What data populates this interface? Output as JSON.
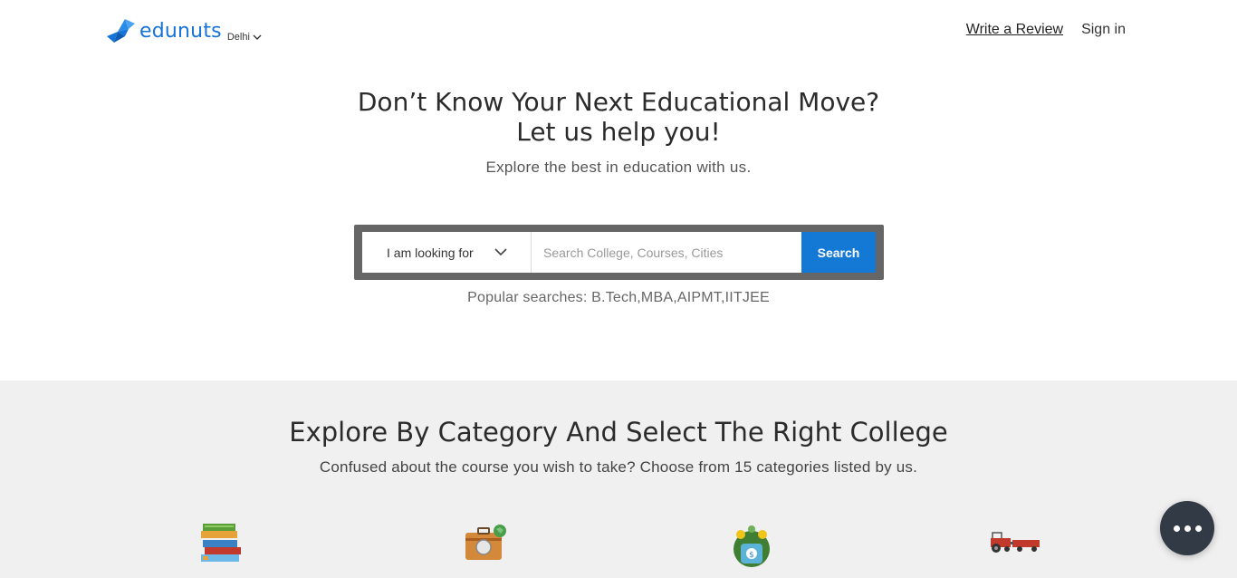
{
  "brand": {
    "name": "edunuts",
    "color": "#1673d8"
  },
  "header": {
    "city": "Delhi",
    "nav": {
      "write_review": "Write a Review",
      "sign_in": "Sign in"
    }
  },
  "hero": {
    "title_line1": "Don’t Know Your Next Educational Move?",
    "title_line2": "Let us help you!",
    "subtitle": "Explore the best in education with us."
  },
  "search": {
    "looking_for_label": "I am looking for",
    "input_placeholder": "Search College, Courses, Cities",
    "input_value": "",
    "button_label": "Search",
    "button_color": "#1479d4"
  },
  "popular": {
    "text": "Popular searches: B.Tech,MBA,AIPMT,IITJEE"
  },
  "category": {
    "title": "Explore By Category And Select The Right College",
    "description": "Confused about the course you wish to take? Choose from 15 categories listed by us.",
    "icons": [
      "books-icon",
      "briefcase-globe-icon",
      "money-bag-icon",
      "tractor-icon"
    ]
  },
  "chat": {
    "icon": "more-dots-icon"
  }
}
